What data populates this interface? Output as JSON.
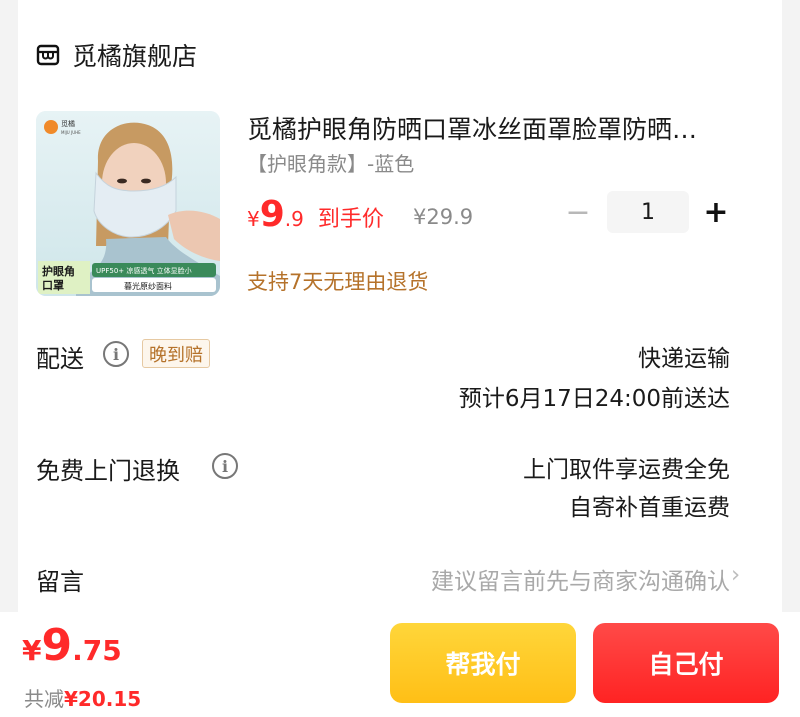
{
  "store": {
    "name": "觅橘旗舰店",
    "icon": "store-icon"
  },
  "product": {
    "title": "觅橘护眼角防晒口罩冰丝面罩脸罩防晒口罩",
    "variant": "【护眼角款】-蓝色",
    "price_symbol": "¥",
    "price_int": "9",
    "price_dec": ".9",
    "price_tag": "到手价",
    "original_price": "¥29.9",
    "returns_note": "支持7天无理由退货",
    "image_brand": "觅橘",
    "image_brand_en": "MIJU JUHE",
    "image_badge": "护眼角\n口罩",
    "image_caption_top": "UPF50+ 凉感透气 立体显脸小",
    "image_caption_bottom": "暮光原纱面料"
  },
  "quantity": {
    "minus": "−",
    "value": "1",
    "plus": "+"
  },
  "delivery": {
    "label": "配送",
    "badge": "晚到赔",
    "method": "快递运输",
    "eta": "预计6月17日24:00前送达"
  },
  "free_return": {
    "label": "免费上门退换",
    "line1": "上门取件享运费全免",
    "line2": "自寄补首重运费"
  },
  "remark": {
    "label": "留言",
    "placeholder": "建议留言前先与商家沟通确认",
    "chevron": "›"
  },
  "footer": {
    "total_symbol": "¥",
    "total_int": "9",
    "total_dec": ".75",
    "discount_label": "共减",
    "discount_value": "¥20.15",
    "help_pay_label": "帮我付",
    "self_pay_label": "自己付"
  },
  "colors": {
    "accent_red": "#ff2a2a",
    "help_button": "#ffcb2a",
    "self_button": "#ff3434",
    "returns_text": "#b5722a"
  }
}
